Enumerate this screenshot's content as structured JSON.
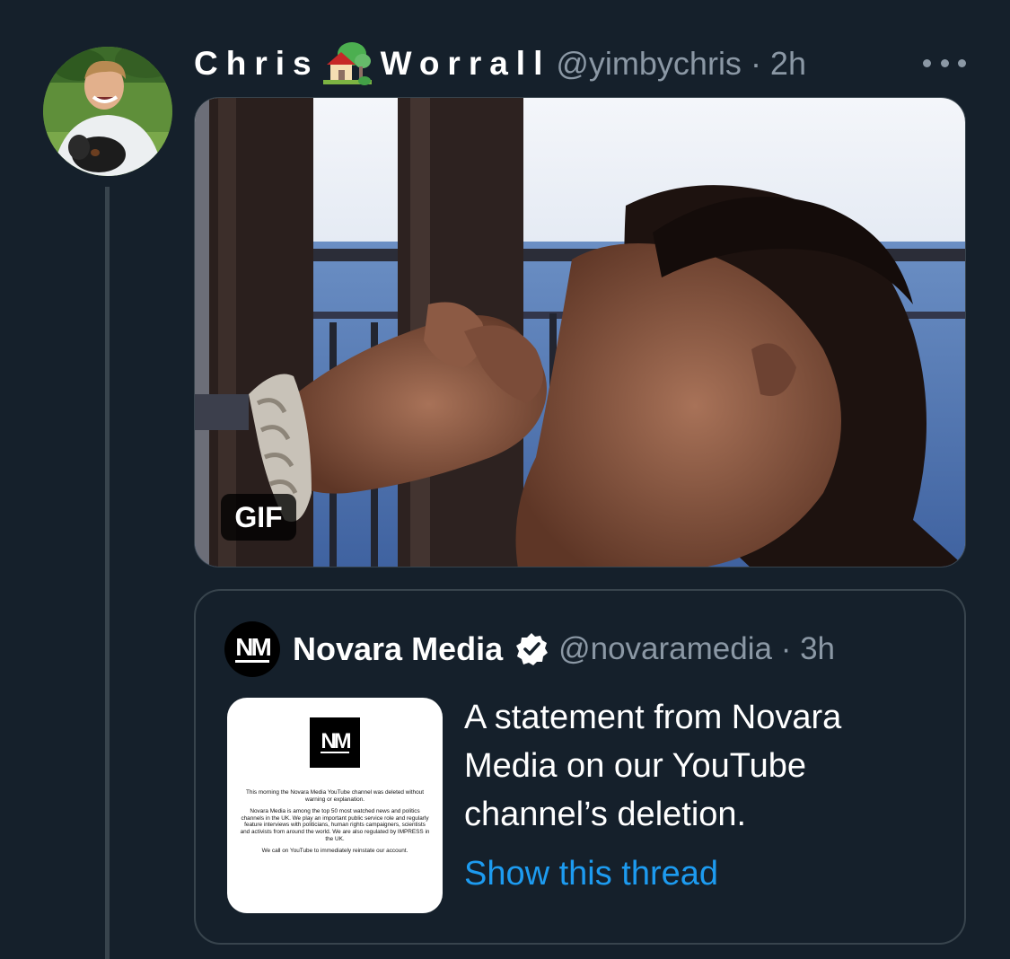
{
  "tweet": {
    "display_name_first": "Chris",
    "display_name_last": "Worrall",
    "name_emoji": "house-with-garden-icon",
    "handle_time": "@yimbychris · 2h",
    "media_badge": "GIF"
  },
  "quoted": {
    "name": "Novara Media",
    "handle_time": "@novaramedia · 3h",
    "logo_text": "NM",
    "text": "A statement from Novara Media on our YouTube channel’s deletion.",
    "show_thread": "Show this thread",
    "thumbnail": {
      "logo_text": "NM",
      "para1": "This morning the Novara Media YouTube channel was deleted without warning or explanation.",
      "para2": "Novara Media is among the top 50 most watched news and politics channels in the UK. We play an important public service role and regularly feature interviews with politicians, human rights campaigners, scientists and activists from around the world. We are also regulated by IMPRESS in the UK.",
      "para3": "We call on YouTube to immediately reinstate our account."
    }
  },
  "colors": {
    "background": "#15202b",
    "border": "#38444d",
    "secondary_text": "#8b98a5",
    "link": "#1d9bf0"
  }
}
